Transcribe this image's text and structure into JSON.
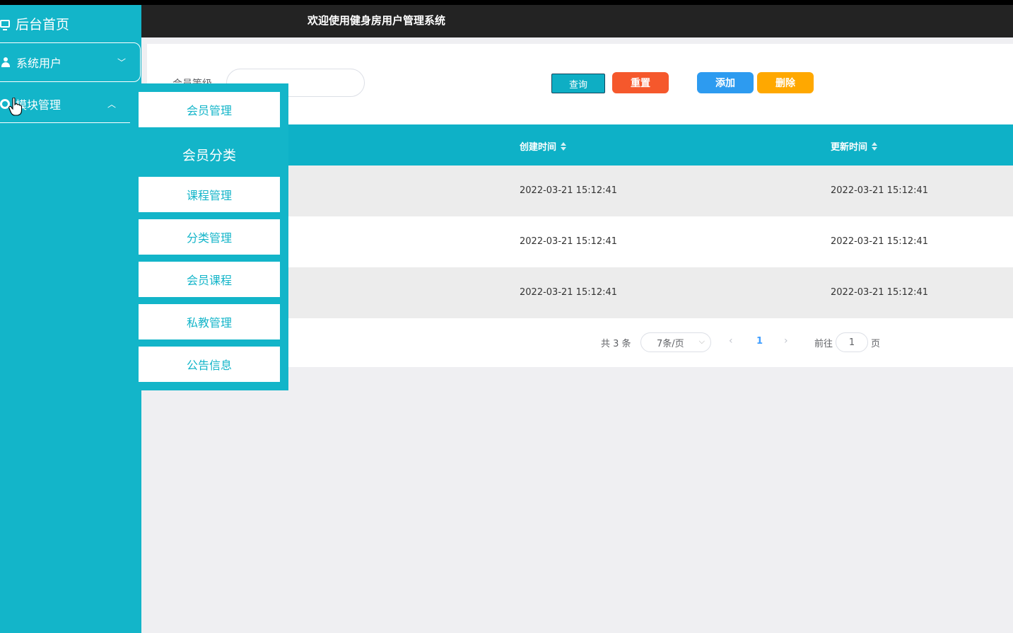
{
  "app": {
    "title": "欢迎使用健身房用户管理系统"
  },
  "sidebar": {
    "home": "后台首页",
    "users": "系统用户",
    "modules": "模块管理",
    "chevron_down": "﹀",
    "chevron_up": "︿",
    "icons": {
      "home": "monitor-icon",
      "users": "user-icon",
      "modules": "gear-icon"
    }
  },
  "submenu": {
    "items": [
      "会员管理",
      "会员分类",
      "课程管理",
      "分类管理",
      "会员课程",
      "私教管理",
      "公告信息"
    ],
    "active_index": 1
  },
  "search": {
    "label": "会员等级",
    "value": "",
    "buttons": {
      "query": "查询",
      "reset": "重置",
      "add": "添加",
      "delete": "删除"
    }
  },
  "table": {
    "columns": [
      "创建时间",
      "更新时间"
    ],
    "rows": [
      [
        "2022-03-21 15:12:41",
        "2022-03-21 15:12:41"
      ],
      [
        "2022-03-21 15:12:41",
        "2022-03-21 15:12:41"
      ],
      [
        "2022-03-21 15:12:41",
        "2022-03-21 15:12:41"
      ]
    ]
  },
  "pagination": {
    "total_text": "共 3 条",
    "page_size": "7条/页",
    "prev": "‹",
    "next": "›",
    "current_page": "1",
    "goto_label": "前往",
    "jump_value": "1",
    "page_suffix": "页"
  },
  "colors": {
    "primary": "#13b5c9",
    "header": "#0eb1c7",
    "topbar": "#232323",
    "reset": "#f5582c",
    "add": "#2d9bf0",
    "delete": "#ffa800"
  }
}
